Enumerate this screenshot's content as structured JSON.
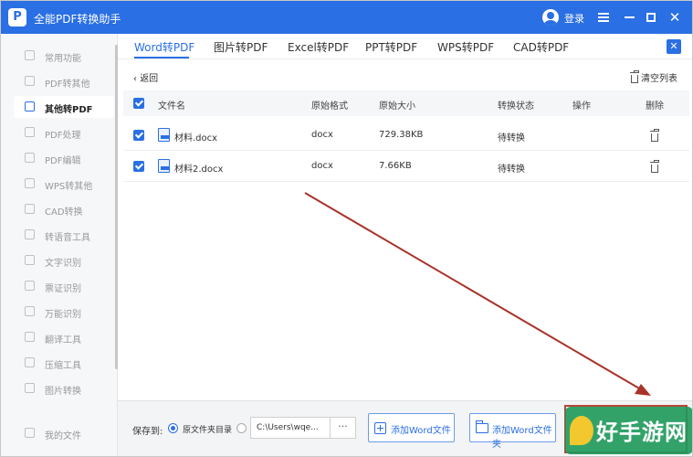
{
  "app": {
    "title": "全能PDF转换助手",
    "logo_glyph": "P",
    "login_label": "登录",
    "close_glyph": "✕"
  },
  "colors": {
    "primary": "#2a6fe3",
    "annotation": "#b5483c",
    "watermark_green": "#1e9a5a",
    "watermark_yellow": "#f2c419"
  },
  "sidebar": {
    "items": [
      {
        "label": "常用功能",
        "icon": "star-icon"
      },
      {
        "label": "PDF转其他",
        "icon": "pdf-icon"
      },
      {
        "label": "其他转PDF",
        "icon": "convert-icon",
        "active": true
      },
      {
        "label": "PDF处理",
        "icon": "tool-icon"
      },
      {
        "label": "PDF编辑",
        "icon": "edit-icon"
      },
      {
        "label": "WPS转其他",
        "icon": "wps-icon"
      },
      {
        "label": "CAD转换",
        "icon": "cad-icon"
      },
      {
        "label": "转语音工具",
        "icon": "voice-icon"
      },
      {
        "label": "文字识别",
        "icon": "ocr-icon"
      },
      {
        "label": "票证识别",
        "icon": "ticket-icon"
      },
      {
        "label": "万能识别",
        "icon": "scan-icon"
      },
      {
        "label": "翻译工具",
        "icon": "translate-icon"
      },
      {
        "label": "压缩工具",
        "icon": "compress-icon"
      },
      {
        "label": "图片转换",
        "icon": "image-icon"
      },
      {
        "label": "我的文件",
        "icon": "folder-icon"
      }
    ]
  },
  "tabs": [
    {
      "label": "Word转PDF",
      "active": true
    },
    {
      "label": "图片转PDF"
    },
    {
      "label": "Excel转PDF"
    },
    {
      "label": "PPT转PDF"
    },
    {
      "label": "WPS转PDF"
    },
    {
      "label": "CAD转PDF"
    }
  ],
  "toolbar": {
    "back_label": "返回",
    "clear_label": "清空列表"
  },
  "table": {
    "headers": {
      "name": "文件名",
      "format": "原始格式",
      "size": "原始大小",
      "status": "转换状态",
      "action": "操作",
      "delete": "删除"
    },
    "rows": [
      {
        "name": "材料.docx",
        "format": "docx",
        "size": "729.38KB",
        "status": "待转换"
      },
      {
        "name": "材料2.docx",
        "format": "docx",
        "size": "7.66KB",
        "status": "待转换"
      }
    ]
  },
  "bottom": {
    "save_to_label": "保存到:",
    "source_dir_label": "原文件夹目录",
    "path_value": "C:\\Users\\wqe...",
    "path_more": "···",
    "add_file_label": "添加Word文件",
    "add_folder_label": "添加Word文件夹"
  },
  "watermark": {
    "text": "好手游网"
  }
}
